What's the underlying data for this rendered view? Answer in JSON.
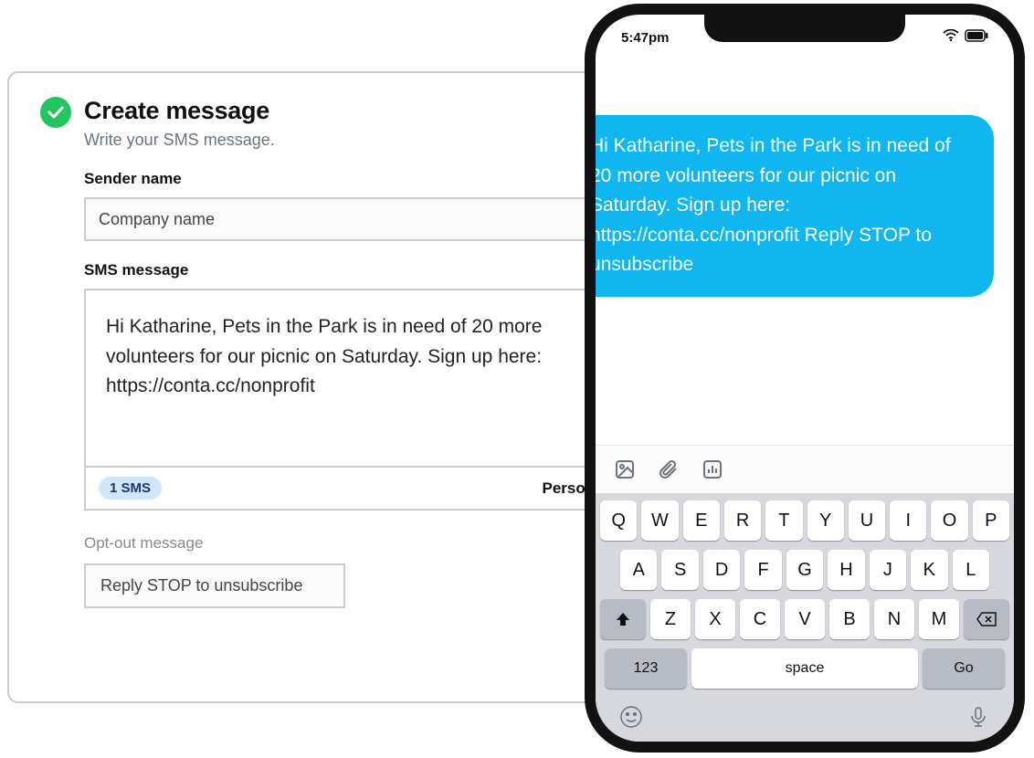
{
  "panel": {
    "title": "Create message",
    "subtitle": "Write your SMS message.",
    "sender_label": "Sender name",
    "sender_value": "Company name",
    "sms_label": "SMS message",
    "sms_text": "Hi Katharine, Pets in the Park is in need of 20 more volunteers for our picnic on Saturday. Sign up here: https://conta.cc/nonprofit",
    "sms_badge": "1 SMS",
    "personalize_label": "Personalize",
    "opt_out_label": "Opt-out message",
    "opt_out_value": "Reply STOP to unsubscribe"
  },
  "phone": {
    "time": "5:47pm",
    "bubble_text": "Hi Katharine, Pets in the Park is in need of 20 more volunteers for our picnic on Saturday. Sign up here: https://conta.cc/nonprofit Reply STOP to unsubscribe",
    "keyboard": {
      "row1": [
        "Q",
        "W",
        "E",
        "R",
        "T",
        "Y",
        "U",
        "I",
        "O",
        "P"
      ],
      "row2": [
        "A",
        "S",
        "D",
        "F",
        "G",
        "H",
        "J",
        "K",
        "L"
      ],
      "row3": [
        "Z",
        "X",
        "C",
        "V",
        "B",
        "N",
        "M"
      ],
      "key_123": "123",
      "key_space": "space",
      "key_go": "Go"
    }
  }
}
